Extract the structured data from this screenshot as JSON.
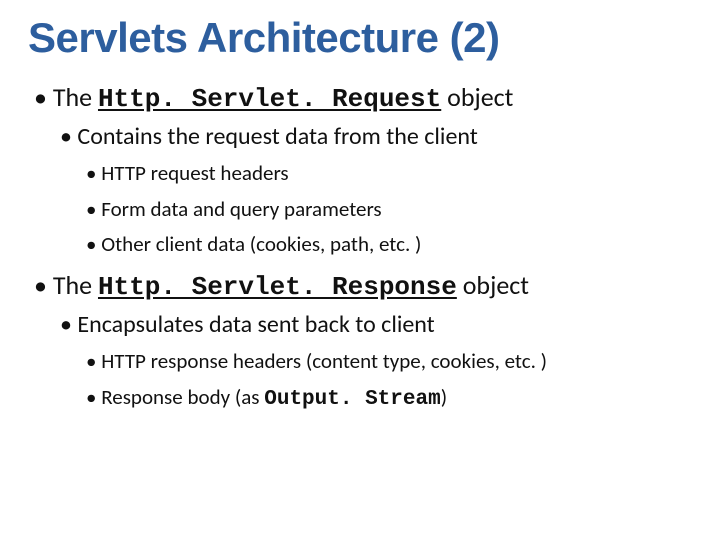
{
  "title": "Servlets Architecture (2)",
  "items": [
    {
      "prefix": "The ",
      "code": "Http. Servlet. Request",
      "suffix": " object",
      "children": [
        {
          "text": "Contains the request data from the client",
          "children": [
            {
              "text": "HTTP request headers"
            },
            {
              "text": "Form data and query parameters"
            },
            {
              "text": "Other client data (cookies, path, etc. )"
            }
          ]
        }
      ]
    },
    {
      "prefix": "The ",
      "code": "Http. Servlet. Response",
      "suffix": " object",
      "children": [
        {
          "text": "Encapsulates data sent back to client",
          "children": [
            {
              "text": "HTTP response headers (content type, cookies, etc. )"
            },
            {
              "prefix": "Response body (as ",
              "code_inline": "Output. Stream",
              "suffix": ")"
            }
          ]
        }
      ]
    }
  ]
}
